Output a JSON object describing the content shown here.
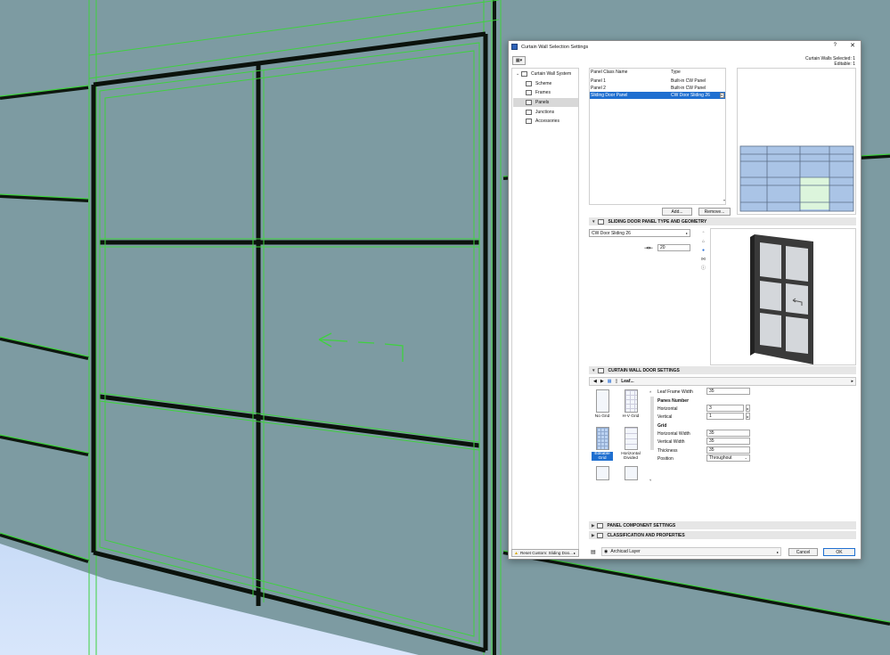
{
  "dialog": {
    "title": "Curtain Wall Selection Settings",
    "help": "?",
    "close": "✕",
    "selected_info": "Curtain Walls Selected: 1",
    "editable_info": "Editable: 1"
  },
  "tree": {
    "root": "Curtain Wall System",
    "items": [
      {
        "label": "Scheme"
      },
      {
        "label": "Frames"
      },
      {
        "label": "Panels"
      },
      {
        "label": "Junctions"
      },
      {
        "label": "Accessories"
      }
    ],
    "reset_label": "Reset Custom: Sliding Doo..."
  },
  "panel_list": {
    "col_name": "Panel Class Name",
    "col_type": "Type",
    "rows": [
      {
        "name": "Panel 1",
        "type": "Built-in CW Panel"
      },
      {
        "name": "Panel 2",
        "type": "Built-in CW Panel"
      },
      {
        "name": "Sliding Door Panel",
        "type": "CW Door Sliding 26"
      }
    ],
    "add_label": "Add...",
    "remove_label": "Remove..."
  },
  "sections": {
    "type_geometry": "SLIDING DOOR PANEL TYPE AND GEOMETRY",
    "door_settings": "CURTAIN WALL DOOR SETTINGS",
    "component_settings": "PANEL COMPONENT SETTINGS",
    "classification": "CLASSIFICATION AND PROPERTIES"
  },
  "geometry": {
    "door_type": "CW Door Sliding 26",
    "offset_value": "20"
  },
  "door_settings": {
    "nav_label": "Leaf...",
    "leaf_frame_width_label": "Leaf Frame Width",
    "leaf_frame_width": "35",
    "panes_number_label": "Panes Number",
    "horizontal_label": "Horizontal",
    "horizontal_value": "3",
    "vertical_label": "Vertical",
    "vertical_value": "1",
    "grid_label": "Grid",
    "h_width_label": "Horizontal Width",
    "h_width_value": "35",
    "v_width_label": "Vertical Width",
    "v_width_value": "35",
    "thickness_label": "Thickness",
    "thickness_value": "35",
    "position_label": "Position",
    "position_value": "Throughout"
  },
  "gallery": {
    "items": [
      {
        "label": "No Grid"
      },
      {
        "label": "H-V Grid"
      },
      {
        "label": "Editable Grid"
      },
      {
        "label": "Horizontal Divided"
      }
    ]
  },
  "bottom": {
    "layer": "Archicad Layer",
    "cancel": "Cancel",
    "ok": "OK"
  },
  "colors": {
    "accent": "#1f6fd0",
    "frame_green": "#3fd13f",
    "glass": "#7d9ba2"
  }
}
